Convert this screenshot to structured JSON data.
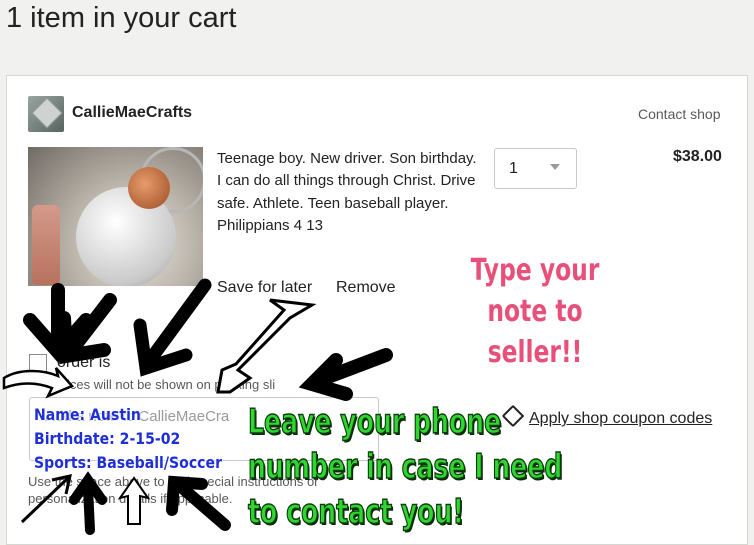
{
  "header": {
    "title": "1 item in your cart"
  },
  "shop": {
    "name": "CallieMaeCrafts",
    "contact_label": "Contact shop"
  },
  "item": {
    "description": "Teenage boy. New driver. Son birthday. I can do all things through Christ. Drive safe. Athlete. Teen baseball player. Philippians 4 13",
    "quantity": "1",
    "price": "$38.00",
    "save_for_later_label": "Save for later",
    "remove_label": "Remove"
  },
  "gift": {
    "label_visible": "order is",
    "prices_note_visible": "Prices will not be shown on packing sli"
  },
  "note": {
    "placeholder_visible": "Add a note to CallieMaeCra",
    "instructions_visible": "Use the space above to add special instructions or personalization details if applicable."
  },
  "coupon": {
    "label": "Apply shop coupon codes",
    "icon": "tag-icon"
  },
  "annotations": {
    "seller_note": "Type your note to seller!!",
    "phone_note": "Leave your phone number in case I need to contact you!",
    "name_line": "Name: Austin",
    "birthdate_line": "Birthdate: 2-15-02",
    "sports_line": "Sports: Baseball/Soccer"
  },
  "colors": {
    "annotation_pink": "#e8507a",
    "annotation_green": "#2fd62f",
    "annotation_blue": "#1f2fd8"
  }
}
